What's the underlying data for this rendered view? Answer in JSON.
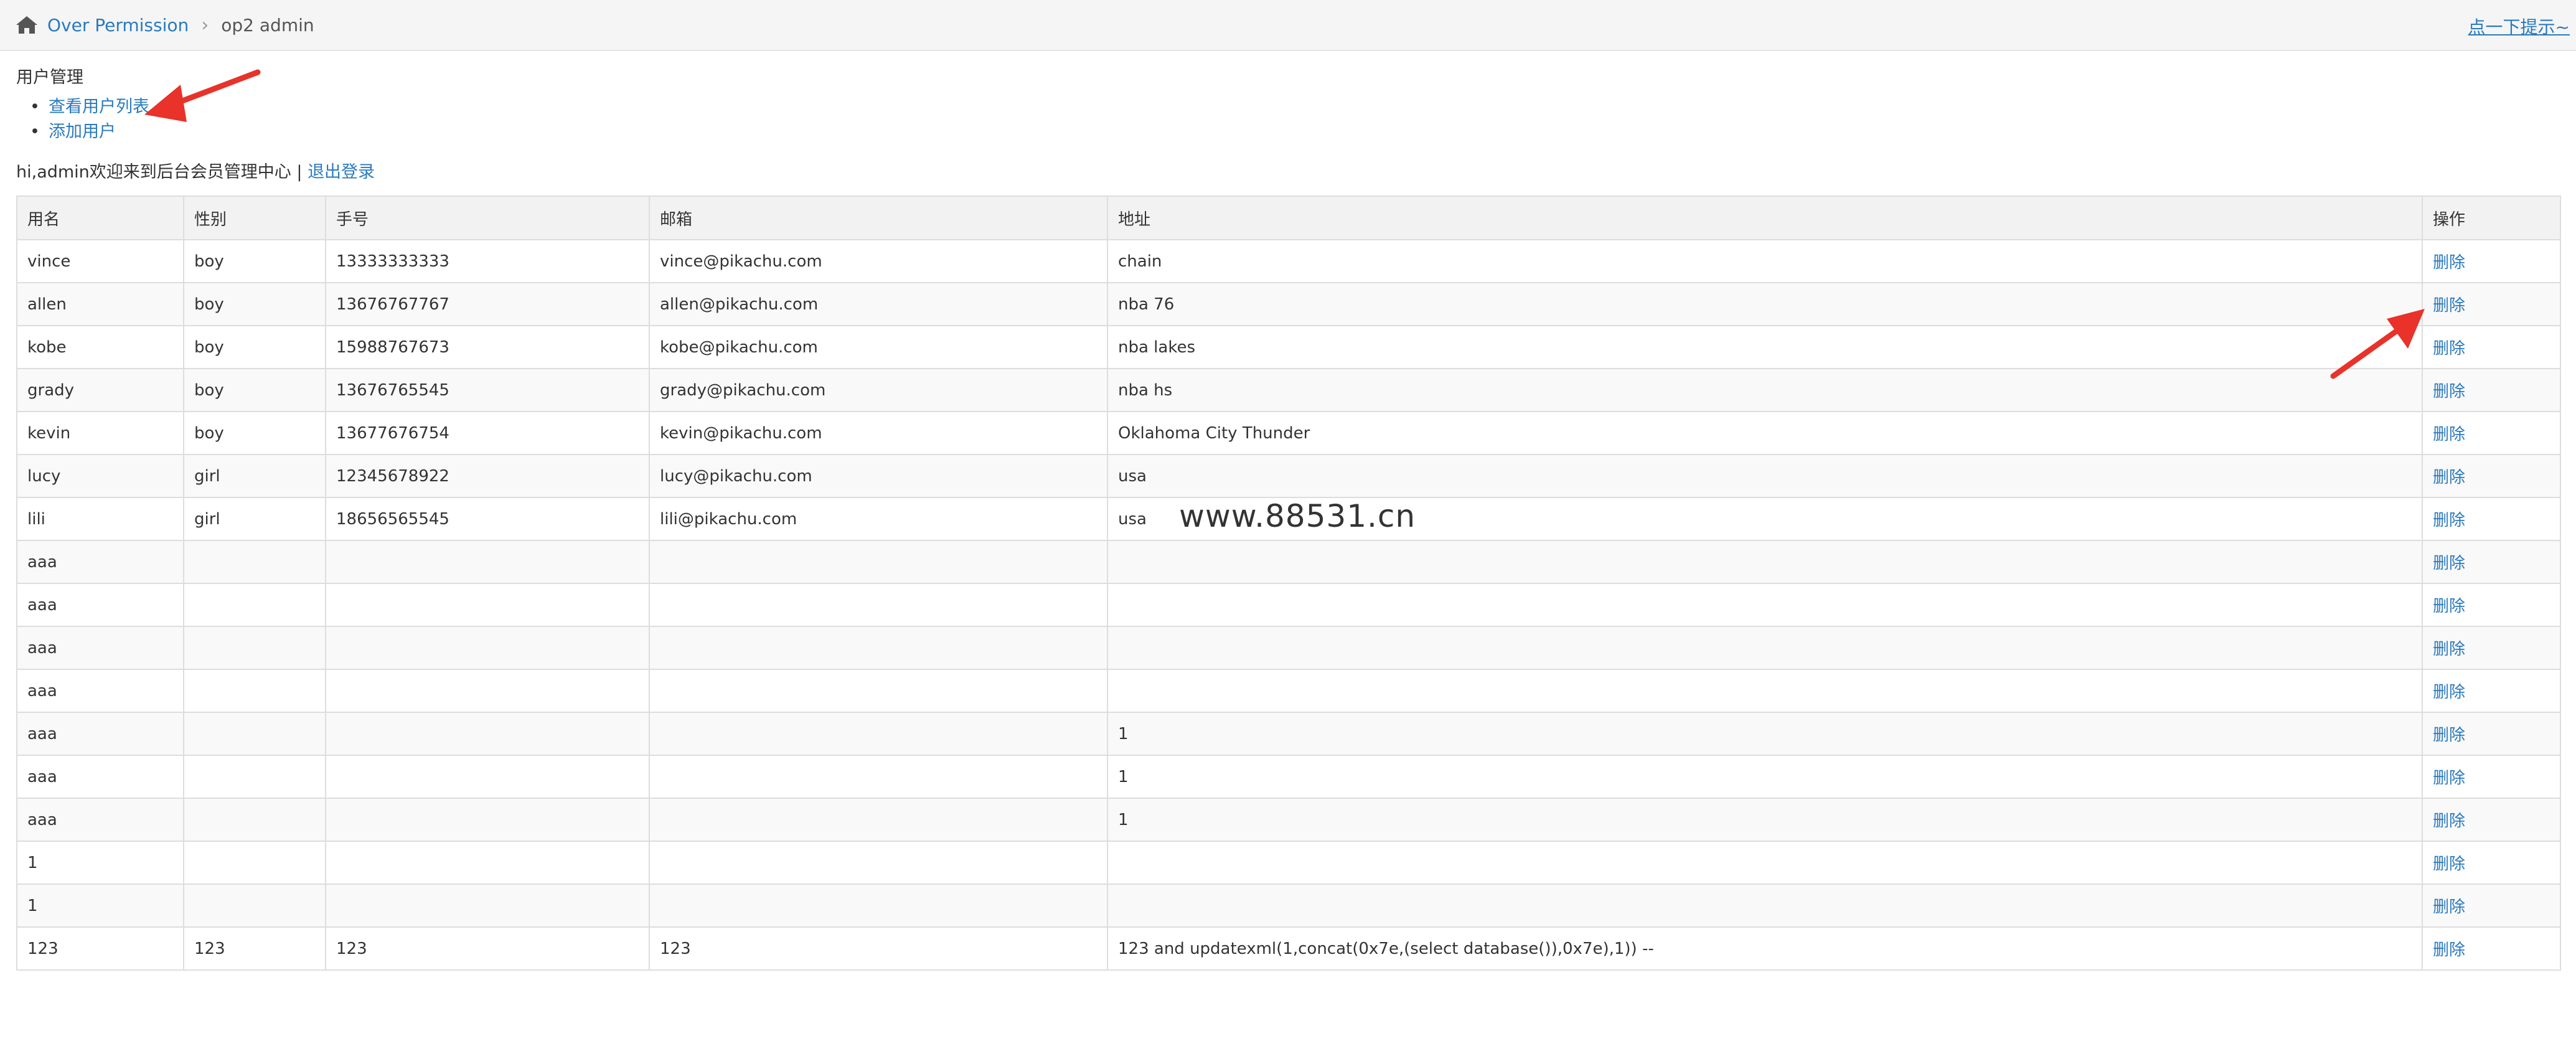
{
  "breadcrumb": {
    "home_icon": "home-icon",
    "section": "Over Permission",
    "current": "op2 admin"
  },
  "hint": "点一下提示~",
  "section_title": "用户管理",
  "menu": {
    "items": [
      "查看用户列表",
      "添加用户"
    ]
  },
  "welcome": {
    "text": "hi,admin欢迎来到后台会员管理中心 | ",
    "logout": "退出登录"
  },
  "table": {
    "headers": [
      "用名",
      "性别",
      "手号",
      "邮箱",
      "地址",
      "操作"
    ],
    "rows": [
      [
        "vince",
        "boy",
        "13333333333",
        "vince@pikachu.com",
        "chain",
        "删除"
      ],
      [
        "allen",
        "boy",
        "13676767767",
        "allen@pikachu.com",
        "nba 76",
        "删除"
      ],
      [
        "kobe",
        "boy",
        "15988767673",
        "kobe@pikachu.com",
        "nba lakes",
        "删除"
      ],
      [
        "grady",
        "boy",
        "13676765545",
        "grady@pikachu.com",
        "nba hs",
        "删除"
      ],
      [
        "kevin",
        "boy",
        "13677676754",
        "kevin@pikachu.com",
        "Oklahoma City Thunder",
        "删除"
      ],
      [
        "lucy",
        "girl",
        "12345678922",
        "lucy@pikachu.com",
        "usa",
        "删除"
      ],
      [
        "lili",
        "girl",
        "18656565545",
        "lili@pikachu.com",
        "usa",
        "删除"
      ],
      [
        "aaa",
        "",
        "",
        "",
        "",
        "删除"
      ],
      [
        "aaa",
        "",
        "",
        "",
        "",
        "删除"
      ],
      [
        "aaa",
        "",
        "",
        "",
        "",
        "删除"
      ],
      [
        "aaa",
        "",
        "",
        "",
        "",
        "删除"
      ],
      [
        "aaa",
        "",
        "",
        "",
        "1",
        "删除"
      ],
      [
        "aaa",
        "",
        "",
        "",
        "1",
        "删除"
      ],
      [
        "aaa",
        "",
        "",
        "",
        "1",
        "删除"
      ],
      [
        "1",
        "",
        "",
        "",
        "",
        "删除"
      ],
      [
        "1",
        "",
        "",
        "",
        "",
        "删除"
      ],
      [
        "123",
        "123",
        "123",
        "123",
        "123 and updatexml(1,concat(0x7e,(select database()),0x7e),1)) --",
        "删除"
      ]
    ]
  },
  "watermark": "www.88531.cn",
  "colors": {
    "link": "#2a7abf",
    "annotation_arrow": "#e8322a"
  }
}
